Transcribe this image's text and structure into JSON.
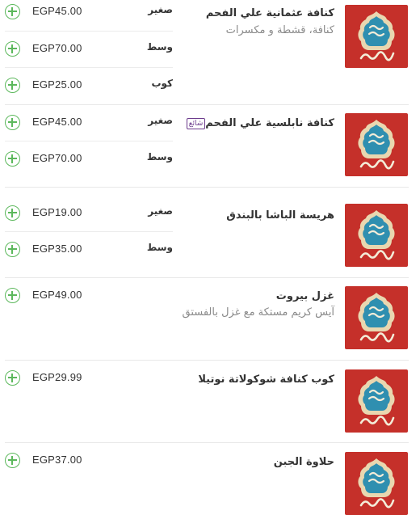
{
  "currency": "EGP",
  "brand_color": "#c5302a",
  "accent_color": "#5cb85c",
  "thumbnail_icon": "abu-fares-al-soury-logo",
  "add_icon": "plus-circle-icon",
  "items": [
    {
      "name": "كنافة عثمانية علي الفحم",
      "description": "كنافة، قشطة و مكسرات",
      "badge": "",
      "options": [
        {
          "size": "صغير",
          "price": "EGP45.00"
        },
        {
          "size": "وسط",
          "price": "EGP70.00"
        },
        {
          "size": "كوب",
          "price": "EGP25.00"
        }
      ]
    },
    {
      "name": "كنافة نابلسية علي الفحم",
      "description": "",
      "badge": "شائع",
      "options": [
        {
          "size": "صغير",
          "price": "EGP45.00"
        },
        {
          "size": "وسط",
          "price": "EGP70.00"
        }
      ]
    },
    {
      "name": "هريسة الباشا بالبندق",
      "description": "",
      "badge": "",
      "options": [
        {
          "size": "صغير",
          "price": "EGP19.00"
        },
        {
          "size": "وسط",
          "price": "EGP35.00"
        }
      ]
    },
    {
      "name": "غزل بيروت",
      "description": "آيس كريم مستكة مع غزل بالفستق",
      "badge": "",
      "options": [
        {
          "size": "",
          "price": "EGP49.00"
        }
      ]
    },
    {
      "name": "كوب كنافة شوكولاتة نوتيلا",
      "description": "",
      "badge": "",
      "options": [
        {
          "size": "",
          "price": "EGP29.99"
        }
      ]
    },
    {
      "name": "حلاوة الجبن",
      "description": "",
      "badge": "",
      "options": [
        {
          "size": "",
          "price": "EGP37.00"
        }
      ]
    }
  ]
}
